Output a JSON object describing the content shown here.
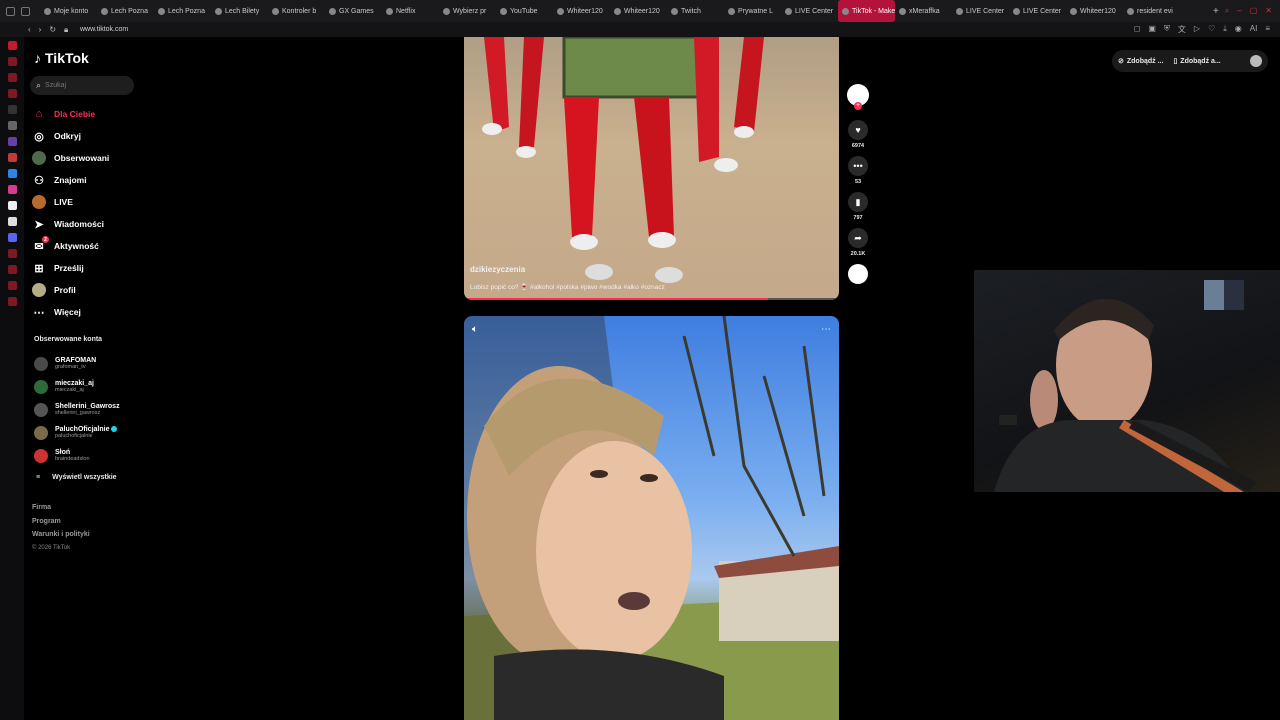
{
  "browser": {
    "tabs": [
      {
        "label": "Moje konto"
      },
      {
        "label": "Lech Pozna"
      },
      {
        "label": "Lech Pozna"
      },
      {
        "label": "Lech Bilety"
      },
      {
        "label": "Kontroler b"
      },
      {
        "label": "GX Games"
      },
      {
        "label": "Netflix"
      },
      {
        "label": "Wybierz pr"
      },
      {
        "label": "YouTube"
      },
      {
        "label": "Whiteer120"
      },
      {
        "label": "Whiteer120"
      },
      {
        "label": "Twitch"
      },
      {
        "label": "Prywatne L"
      },
      {
        "label": "LIVE Center"
      },
      {
        "label": "TikTok - Make Yo"
      },
      {
        "label": "xMeraffka"
      },
      {
        "label": "LIVE Center"
      },
      {
        "label": "LIVE Center"
      },
      {
        "label": "Whiteer120"
      },
      {
        "label": "resident evi"
      }
    ],
    "new_tab": "+",
    "url": "www.tiktok.com",
    "active_tab_color": "#b3123a"
  },
  "sidebar": {
    "logo": "TikTok",
    "search_placeholder": "Szukaj",
    "nav": [
      {
        "label": "Dla Ciebie",
        "icon": "home-icon"
      },
      {
        "label": "Odkryj",
        "icon": "compass-icon"
      },
      {
        "label": "Obserwowani",
        "icon": "following-avatar-icon"
      },
      {
        "label": "Znajomi",
        "icon": "friends-icon"
      },
      {
        "label": "LIVE",
        "icon": "live-avatar-icon"
      },
      {
        "label": "Wiadomości",
        "icon": "send-icon"
      },
      {
        "label": "Aktywność",
        "icon": "inbox-icon",
        "badge": "2"
      },
      {
        "label": "Prześlij",
        "icon": "upload-icon"
      },
      {
        "label": "Profil",
        "icon": "profile-avatar-icon"
      },
      {
        "label": "Więcej",
        "icon": "more-icon"
      }
    ],
    "followed_title": "Obserwowane konta",
    "followed": [
      {
        "name": "GRAFOMAN",
        "handle": "grafoman_tv"
      },
      {
        "name": "mieczaki_aj",
        "handle": "mieczaki_aj"
      },
      {
        "name": "Shellerini_Gawrosz",
        "handle": "shellerini_gawrosz"
      },
      {
        "name": "PaluchOficjalnie",
        "handle": "paluchoficjalnie",
        "verified": true
      },
      {
        "name": "Słoń",
        "handle": "braindeadslon"
      }
    ],
    "see_all": "Wyświetl wszystkie",
    "footer": [
      "Firma",
      "Program",
      "Warunki i polityki"
    ],
    "copyright": "© 2026 TikTok"
  },
  "video1": {
    "username": "dzikiezyczenia",
    "caption": "Lubisz popić co? 🍷 #alkohol #polska #piwo #wodka #alko #oznacz",
    "progress": 0.81
  },
  "actions": {
    "likes": "6974",
    "comments": "53",
    "saves": "797",
    "shares": "20.1K"
  },
  "download": {
    "btn1": "Zdobądź ...",
    "btn2": "Zdobądź a..."
  }
}
